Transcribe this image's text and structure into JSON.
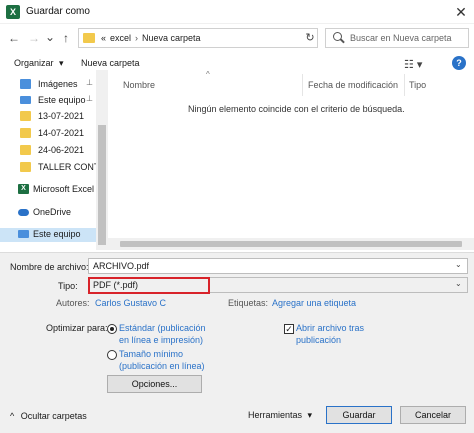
{
  "window": {
    "title": "Guardar como",
    "app_icon": "excel-icon",
    "close_glyph": "✕"
  },
  "nav": {
    "back": "←",
    "forward": "→",
    "recent": "⌄",
    "up": "↑",
    "address": {
      "prefix": "«",
      "crumbs": [
        "excel",
        "Nueva carpeta"
      ]
    },
    "refresh": "↻",
    "search_placeholder": "Buscar en Nueva carpeta"
  },
  "toolbar": {
    "organize": "Organizar",
    "organize_chevron": "▾",
    "new_folder": "Nueva carpeta",
    "view_glyph": "☷ ▾",
    "help_glyph": "?"
  },
  "sidebar": {
    "items": [
      {
        "label": "Imágenes",
        "icon": "images-icon",
        "pinned": true
      },
      {
        "label": "Este equipo",
        "icon": "computer-icon",
        "pinned": true
      },
      {
        "label": "13-07-2021",
        "icon": "folder-icon"
      },
      {
        "label": "14-07-2021",
        "icon": "folder-icon"
      },
      {
        "label": "24-06-2021",
        "icon": "folder-icon"
      },
      {
        "label": "TALLER CONTR",
        "icon": "folder-icon"
      },
      {
        "label": "Microsoft Excel",
        "icon": "excel-icon"
      },
      {
        "label": "OneDrive",
        "icon": "cloud-icon"
      },
      {
        "label": "Este equipo",
        "icon": "computer-icon",
        "selected": true
      }
    ],
    "pin_glyph": "📌"
  },
  "files": {
    "columns": [
      "Nombre",
      "Fecha de modificación",
      "Tipo"
    ],
    "sort_glyph": "^",
    "empty_message": "Ningún elemento coincide con el criterio de búsqueda."
  },
  "form": {
    "filename_label": "Nombre de archivo:",
    "filename_value": "ARCHIVO.pdf",
    "type_label": "Tipo:",
    "type_value": "PDF (*.pdf)",
    "authors_label": "Autores:",
    "authors_value": "Carlos Gustavo C",
    "tags_label": "Etiquetas:",
    "tags_value": "Agregar una etiqueta",
    "optimize_label": "Optimizar para:",
    "option_standard_line1": "Estándar (publicación",
    "option_standard_line2": "en línea e impresión)",
    "option_min_line1": "Tamaño mínimo",
    "option_min_line2": "(publicación en línea)",
    "open_after_line1": "Abrir archivo tras",
    "open_after_line2": "publicación",
    "open_after_checked": true,
    "options_button": "Opciones...",
    "chevron": "⌄"
  },
  "footer": {
    "hide_folders": "Ocultar carpetas",
    "hide_chevron": "^",
    "tools": "Herramientas",
    "tools_chevron": "▾",
    "save": "Guardar",
    "cancel": "Cancelar"
  },
  "colors": {
    "accent": "#2a72c8",
    "highlight": "#d8232a",
    "folder": "#f2c94c",
    "excel": "#1d6f42",
    "selected": "#cce4f7"
  }
}
